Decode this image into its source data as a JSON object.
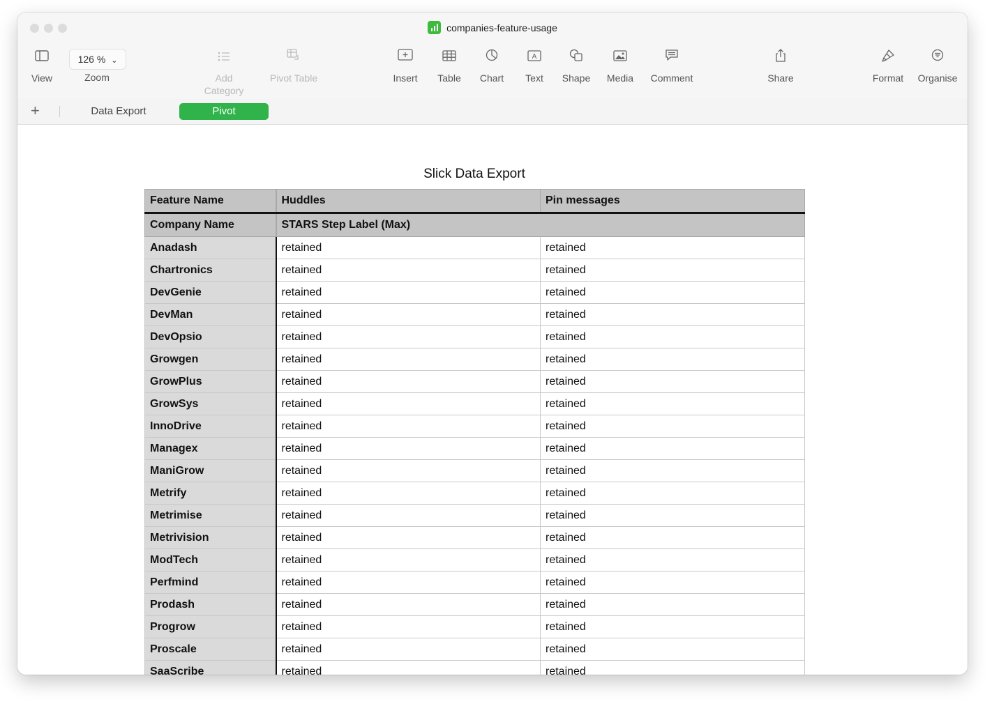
{
  "window": {
    "title": "companies-feature-usage"
  },
  "toolbar": {
    "view": {
      "label": "View",
      "icon": "sidebar-icon"
    },
    "zoom": {
      "value": "126 %",
      "label": "Zoom"
    },
    "add_category": {
      "label": "Add Category",
      "icon": "list-icon"
    },
    "pivot_table": {
      "label": "Pivot Table",
      "icon": "pivot-table-icon"
    },
    "insert": {
      "label": "Insert",
      "icon": "insert-icon"
    },
    "table": {
      "label": "Table",
      "icon": "table-icon"
    },
    "chart": {
      "label": "Chart",
      "icon": "chart-icon"
    },
    "text": {
      "label": "Text",
      "icon": "text-icon"
    },
    "shape": {
      "label": "Shape",
      "icon": "shape-icon"
    },
    "media": {
      "label": "Media",
      "icon": "media-icon"
    },
    "comment": {
      "label": "Comment",
      "icon": "comment-icon"
    },
    "share": {
      "label": "Share",
      "icon": "share-icon"
    },
    "format": {
      "label": "Format",
      "icon": "format-brush-icon"
    },
    "organise": {
      "label": "Organise",
      "icon": "organise-icon"
    }
  },
  "sheets": {
    "add": "+",
    "tabs": [
      {
        "label": "Data Export",
        "active": false
      },
      {
        "label": "Pivot",
        "active": true
      }
    ]
  },
  "colors": {
    "accent": "#2fb34a",
    "header_bg": "#c4c4c4",
    "row_header_bg": "#dadada"
  },
  "table": {
    "title": "Slick Data Export",
    "column_header_label": "Feature Name",
    "columns": [
      "Huddles",
      "Pin messages"
    ],
    "row_header_label": "Company Name",
    "measure_label": "STARS Step Label (Max)",
    "rows": [
      {
        "company": "Anadash",
        "values": [
          "retained",
          "retained"
        ]
      },
      {
        "company": "Chartronics",
        "values": [
          "retained",
          "retained"
        ]
      },
      {
        "company": "DevGenie",
        "values": [
          "retained",
          "retained"
        ]
      },
      {
        "company": "DevMan",
        "values": [
          "retained",
          "retained"
        ]
      },
      {
        "company": "DevOpsio",
        "values": [
          "retained",
          "retained"
        ]
      },
      {
        "company": "Growgen",
        "values": [
          "retained",
          "retained"
        ]
      },
      {
        "company": "GrowPlus",
        "values": [
          "retained",
          "retained"
        ]
      },
      {
        "company": "GrowSys",
        "values": [
          "retained",
          "retained"
        ]
      },
      {
        "company": "InnoDrive",
        "values": [
          "retained",
          "retained"
        ]
      },
      {
        "company": "Managex",
        "values": [
          "retained",
          "retained"
        ]
      },
      {
        "company": "ManiGrow",
        "values": [
          "retained",
          "retained"
        ]
      },
      {
        "company": "Metrify",
        "values": [
          "retained",
          "retained"
        ]
      },
      {
        "company": "Metrimise",
        "values": [
          "retained",
          "retained"
        ]
      },
      {
        "company": "Metrivision",
        "values": [
          "retained",
          "retained"
        ]
      },
      {
        "company": "ModTech",
        "values": [
          "retained",
          "retained"
        ]
      },
      {
        "company": "Perfmind",
        "values": [
          "retained",
          "retained"
        ]
      },
      {
        "company": "Prodash",
        "values": [
          "retained",
          "retained"
        ]
      },
      {
        "company": "Progrow",
        "values": [
          "retained",
          "retained"
        ]
      },
      {
        "company": "Proscale",
        "values": [
          "retained",
          "retained"
        ]
      },
      {
        "company": "SaaScribe",
        "values": [
          "retained",
          "retained"
        ]
      },
      {
        "company": "",
        "values": [
          "",
          ""
        ]
      }
    ]
  }
}
